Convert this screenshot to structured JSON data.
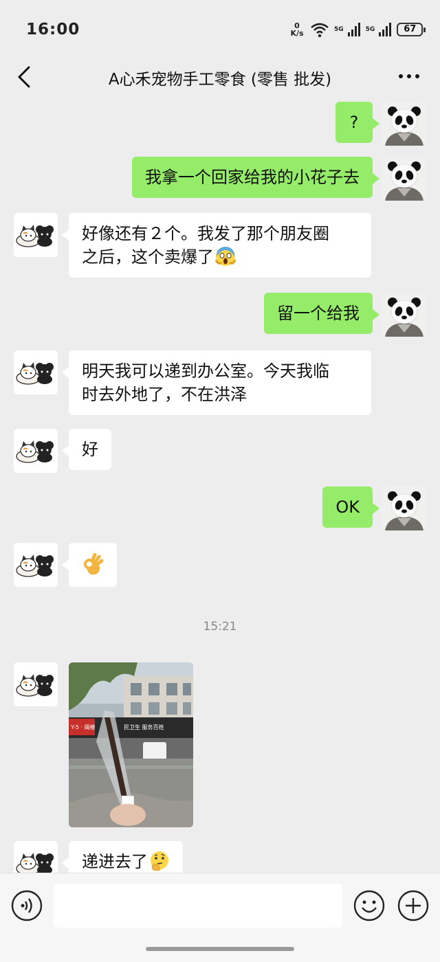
{
  "status_bar": {
    "time": "16:00",
    "net_speed_value": "0",
    "net_speed_unit": "K/s",
    "net_5g_a": "5G",
    "net_5g_b": "5G",
    "battery": "67"
  },
  "header": {
    "title": "A心禾宠物手工零食 (零售 批发)"
  },
  "messages": [
    {
      "from": "me",
      "text": "?"
    },
    {
      "from": "me",
      "text": "我拿一个回家给我的小花子去"
    },
    {
      "from": "them",
      "text_line1": "好像还有２个。我发了那个朋友圈",
      "text_line2": "之后，这个卖爆了",
      "emoji": "screaming-face"
    },
    {
      "from": "me",
      "text": "留一个给我"
    },
    {
      "from": "them",
      "text_line1": "明天我可以递到办公室。今天我临",
      "text_line2": "时去外地了，不在洪泽"
    },
    {
      "from": "them",
      "text": "好"
    },
    {
      "from": "me",
      "text": "OK"
    },
    {
      "from": "them",
      "emoji": "ok-hand"
    },
    {
      "type": "timestamp",
      "text": "15:21"
    },
    {
      "from": "them",
      "type": "image",
      "sign_left": "Y-5 · 闽楼",
      "sign_mid": "民卫生  服务百姓"
    },
    {
      "from": "them",
      "text": "递进去了",
      "emoji": "thinking-face"
    }
  ],
  "icons": [
    "back-arrow-icon",
    "more-icon",
    "voice-icon",
    "emoji-icon",
    "plus-icon",
    "wifi-icon",
    "signal-icon",
    "battery-icon"
  ],
  "colors": {
    "background": "#ededed",
    "my_bubble": "#95ec69",
    "their_bubble": "#ffffff",
    "timestamp": "#888888"
  }
}
